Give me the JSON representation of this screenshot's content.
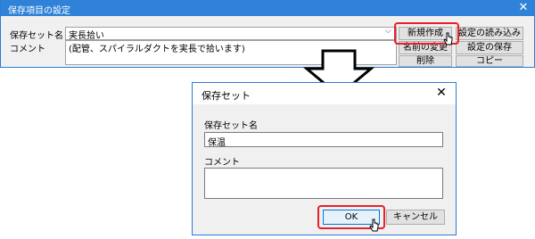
{
  "settings_window": {
    "title": "保存項目の設定",
    "close_glyph": "✕",
    "name_label": "保存セット名",
    "name_value": "実長拾い",
    "dropdown_glyph": "⌵",
    "comment_label": "コメント",
    "comment_value": "(配管、スパイラルダクトを実長で拾います)",
    "buttons": {
      "new": "新規作成",
      "load": "設定の読み込み",
      "rename": "名前の変更",
      "save": "設定の保存",
      "delete": "削除",
      "copy": "コピー"
    }
  },
  "dialog": {
    "title": "保存セット",
    "close_glyph": "✕",
    "name_label": "保存セット名",
    "name_value": "保温",
    "comment_label": "コメント",
    "comment_value": "",
    "ok_label": "OK",
    "cancel_label": "キャンセル"
  },
  "colors": {
    "titlebar": "#2f82d8",
    "highlight": "#e8202a"
  }
}
